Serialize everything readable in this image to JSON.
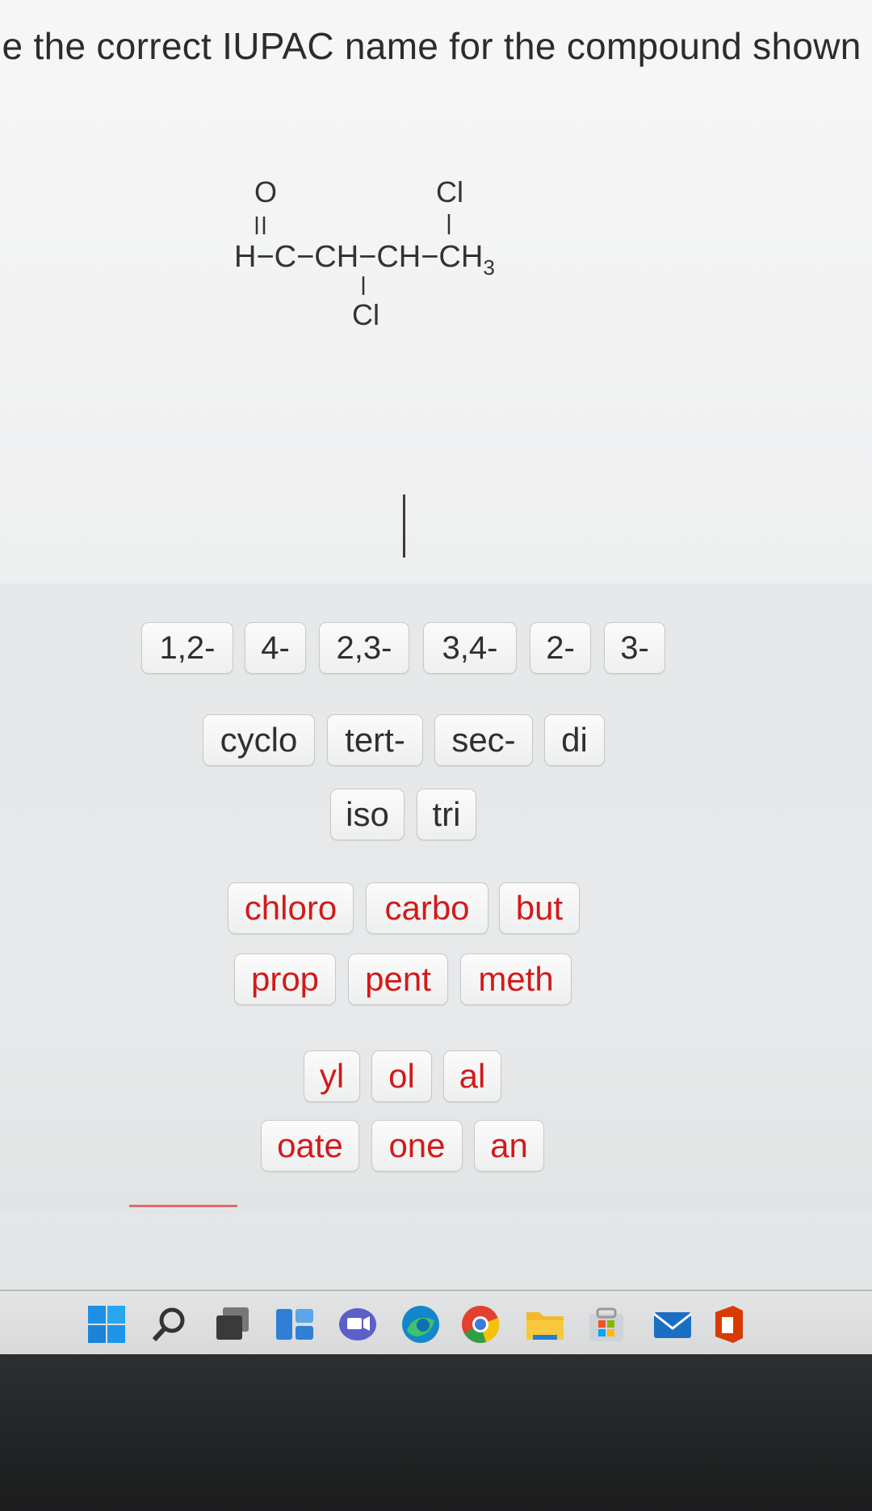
{
  "question": {
    "text": "le the correct IUPAC name for the compound shown he"
  },
  "structure": {
    "top_o": "O",
    "top_cl": "Cl",
    "chain": "H−C−CH−CH−CH",
    "subscript": "3",
    "bottom_cl": "Cl"
  },
  "tiles": {
    "locants": [
      "1,2-",
      "4-",
      "2,3-",
      "3,4-",
      "2-",
      "3-"
    ],
    "prefixes": [
      "cyclo",
      "tert-",
      "sec-",
      "di"
    ],
    "multipliers": [
      "iso",
      "tri"
    ],
    "stems_row1": [
      "chloro",
      "carbo",
      "but"
    ],
    "stems_row2": [
      "prop",
      "pent",
      "meth"
    ],
    "suffixes_row1": [
      "yl",
      "ol",
      "al"
    ],
    "suffixes_row2": [
      "oate",
      "one",
      "an"
    ]
  },
  "taskbar": {
    "icons": [
      "windows-start-icon",
      "search-icon",
      "task-view-icon",
      "widgets-icon",
      "teams-chat-icon",
      "edge-icon",
      "chrome-icon",
      "file-explorer-icon",
      "store-icon",
      "mail-icon",
      "office-icon"
    ]
  },
  "colors": {
    "accent_text": "#d21a1a",
    "tile_border": "#c6c9cc"
  }
}
